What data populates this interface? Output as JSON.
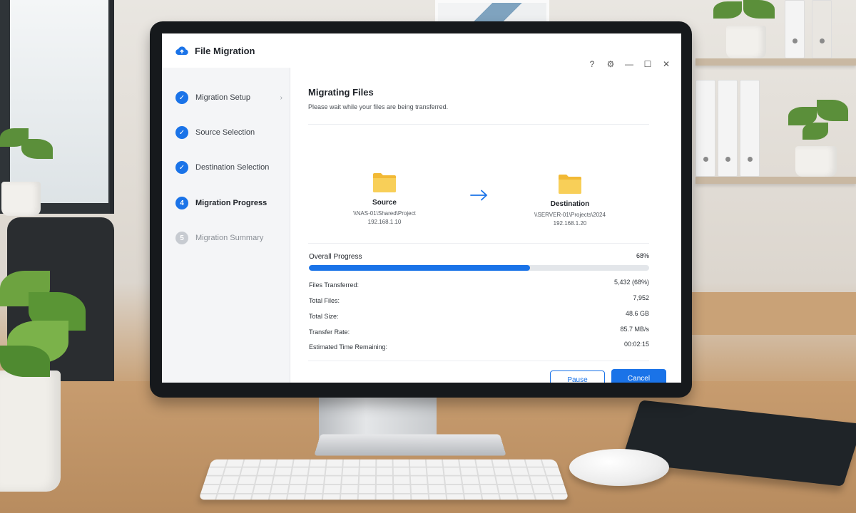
{
  "app": {
    "title": "File Migration",
    "icon": "cloud-icon",
    "window_controls": [
      {
        "name": "help-icon",
        "glyph": "?"
      },
      {
        "name": "gear-icon",
        "glyph": "⚙"
      },
      {
        "name": "minimize-icon",
        "glyph": "—"
      },
      {
        "name": "maximize-icon",
        "glyph": "☐"
      },
      {
        "name": "close-icon",
        "glyph": "✕"
      }
    ]
  },
  "sidebar": {
    "steps": [
      {
        "label": "Migration Setup",
        "status": "done",
        "badge": "✓"
      },
      {
        "label": "Source Selection",
        "status": "done",
        "badge": "✓"
      },
      {
        "label": "Destination Selection",
        "status": "done",
        "badge": "✓"
      },
      {
        "label": "Migration Progress",
        "status": "current",
        "badge": "4"
      },
      {
        "label": "Migration Summary",
        "status": "pending",
        "badge": "5"
      }
    ],
    "chevron": "›"
  },
  "main": {
    "title": "Migrating Files",
    "subtitle": "Please wait while your files are being transferred.",
    "source": {
      "label": "Source",
      "path": "\\\\NAS-01\\Shared\\Project",
      "ip": "192.168.1.10"
    },
    "destination": {
      "label": "Destination",
      "path": "\\\\SERVER-01\\Projects\\2024",
      "ip": "192.168.1.20"
    },
    "progress": {
      "label": "Overall Progress",
      "percent_text": "68%",
      "fraction": 0.65
    },
    "stats": [
      {
        "key": "Files Transferred:",
        "value": "5,432 (68%)"
      },
      {
        "key": "Total Files:",
        "value": "7,952"
      },
      {
        "key": "Total Size:",
        "value": "48.6 GB"
      },
      {
        "key": "Transfer Rate:",
        "value": "85.7 MB/s"
      },
      {
        "key": "Estimated Time Remaining:",
        "value": "00:02:15"
      }
    ],
    "buttons": {
      "pause": "Pause",
      "cancel": "Cancel"
    }
  },
  "colors": {
    "accent": "#1a73e8",
    "folder": "#f6c94a",
    "pending": "#c7cbd1"
  }
}
